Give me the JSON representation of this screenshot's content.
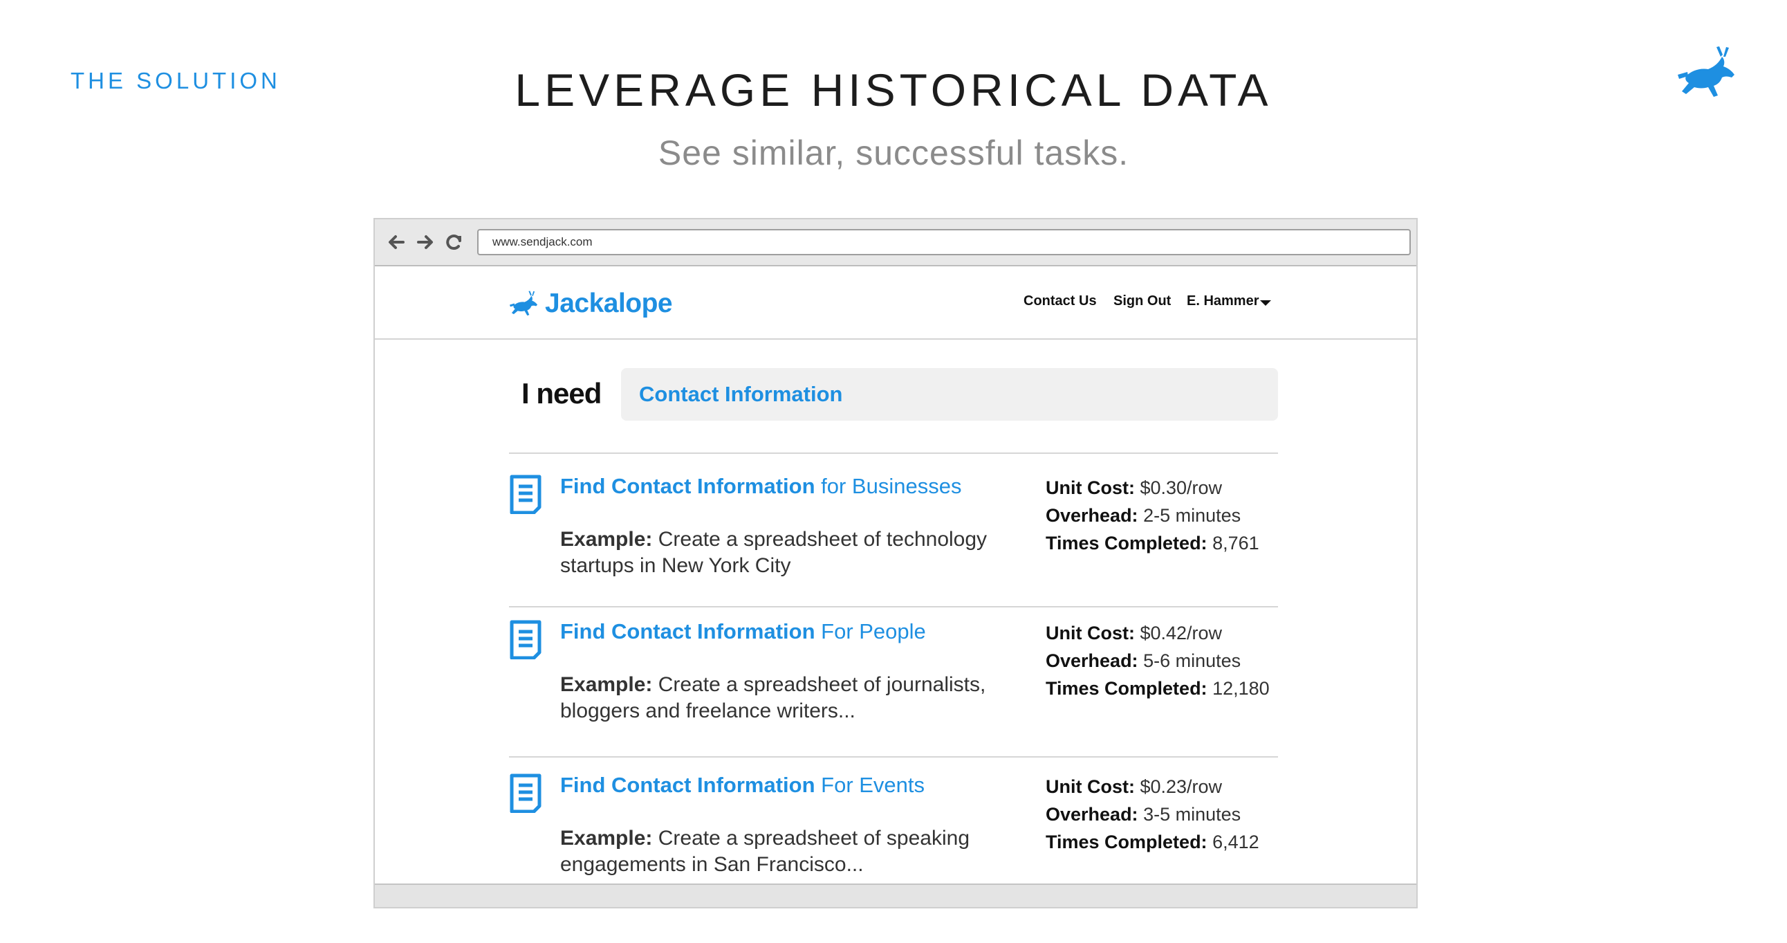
{
  "slide": {
    "eyebrow": "THE SOLUTION",
    "title": "LEVERAGE HISTORICAL DATA",
    "subtitle": "See similar, successful tasks.",
    "accent_color": "#1e8fe1"
  },
  "browser": {
    "url": "www.sendjack.com",
    "nav_icons": [
      "back-arrow-icon",
      "forward-arrow-icon",
      "reload-icon"
    ]
  },
  "site": {
    "brand": "Jackalope",
    "brand_icon": "jackalope-icon",
    "nav": {
      "contact": "Contact Us",
      "signout": "Sign Out",
      "user": "E. Hammer",
      "user_icon": "chevron-down-icon"
    }
  },
  "search": {
    "label": "I need",
    "value": "Contact Information"
  },
  "tasks": [
    {
      "title_strong": "Find Contact Information",
      "title_rest": " for Businesses",
      "example_label": "Example:",
      "example_text": " Create a spreadsheet of technology startups in New York City",
      "unit_cost_label": "Unit Cost:",
      "unit_cost": " $0.30/row",
      "overhead_label": "Overhead:",
      "overhead": " 2-5 minutes",
      "completed_label": "Times Completed:",
      "completed": " 8,761"
    },
    {
      "title_strong": "Find Contact Information",
      "title_rest": " For People",
      "example_label": "Example:",
      "example_text": " Create a spreadsheet of journalists, bloggers and freelance writers...",
      "unit_cost_label": "Unit Cost:",
      "unit_cost": " $0.42/row",
      "overhead_label": "Overhead:",
      "overhead": " 5-6 minutes",
      "completed_label": "Times Completed:",
      "completed": " 12,180"
    },
    {
      "title_strong": "Find Contact Information",
      "title_rest": " For Events",
      "example_label": "Example:",
      "example_text": " Create a spreadsheet of speaking engagements in San Francisco...",
      "unit_cost_label": "Unit Cost:",
      "unit_cost": " $0.23/row",
      "overhead_label": "Overhead:",
      "overhead": " 3-5 minutes",
      "completed_label": "Times Completed:",
      "completed": " 6,412"
    }
  ]
}
